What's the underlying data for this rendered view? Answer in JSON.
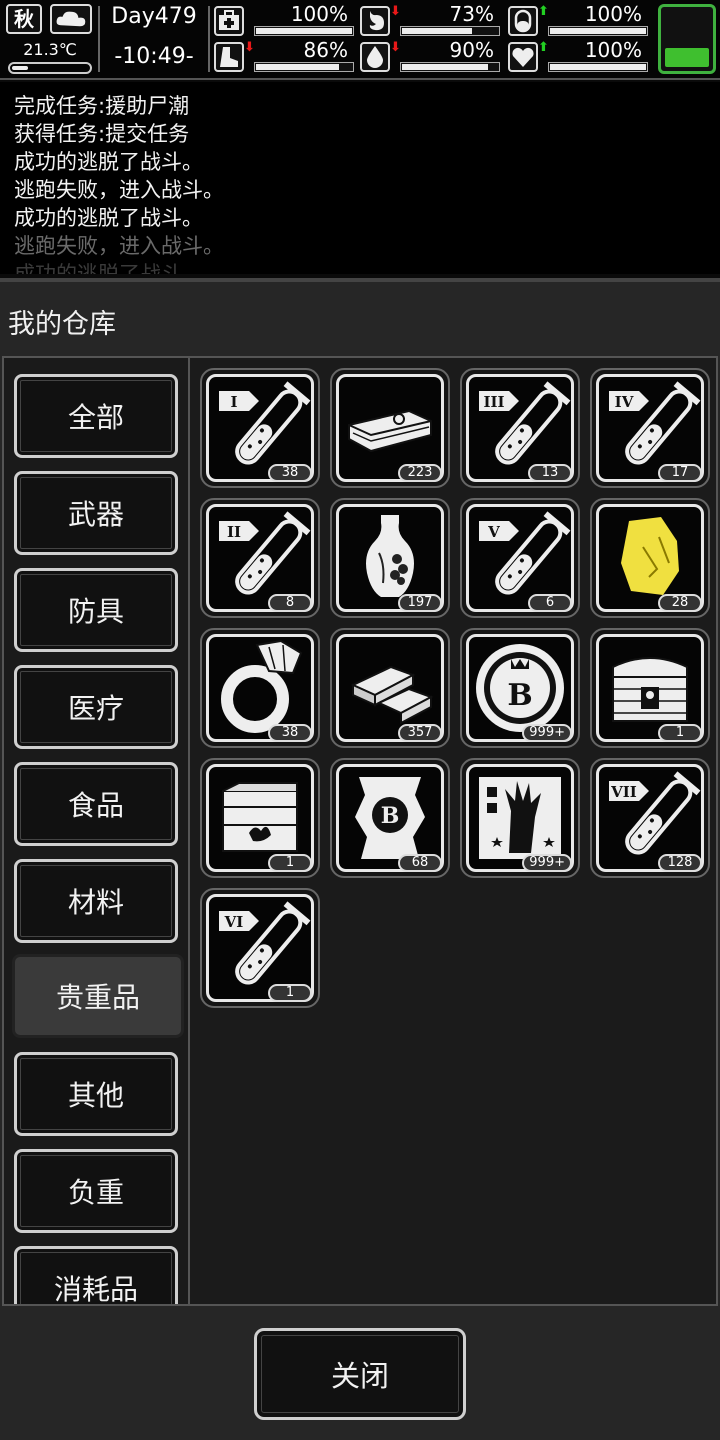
{
  "status": {
    "season": "秋",
    "weather_icon": "cloud-icon",
    "temperature": "21.3℃",
    "temperature_level": 0.2,
    "day": "Day479",
    "time": "-10:49-",
    "stats": [
      {
        "name": "health",
        "icon": "medkit-icon",
        "trend": "none",
        "value": "100%",
        "level": 1.0
      },
      {
        "name": "hunger",
        "icon": "stomach-icon",
        "trend": "down",
        "value": "73%",
        "level": 0.73
      },
      {
        "name": "mood",
        "icon": "pill-icon",
        "trend": "up",
        "value": "100%",
        "level": 1.0
      },
      {
        "name": "stamina",
        "icon": "boot-icon",
        "trend": "down",
        "value": "86%",
        "level": 0.86
      },
      {
        "name": "thirst",
        "icon": "water-drop-icon",
        "trend": "down",
        "value": "90%",
        "level": 0.9
      },
      {
        "name": "spirit",
        "icon": "heart-icon",
        "trend": "up",
        "value": "100%",
        "level": 1.0
      }
    ],
    "battery_level": 0.3,
    "colors": {
      "trend_down": "#e81818",
      "trend_up": "#22d022",
      "battery": "#3fbf2f"
    }
  },
  "log": [
    "完成任务:援助尸潮",
    "获得任务:提交任务",
    "成功的逃脱了战斗。",
    "逃跑失败，进入战斗。",
    "成功的逃脱了战斗。",
    "逃跑失败，进入战斗。",
    "成功的逃脱了战斗。"
  ],
  "panel": {
    "title": "我的仓库",
    "categories": [
      "全部",
      "武器",
      "防具",
      "医疗",
      "食品",
      "材料",
      "贵重品",
      "其他",
      "负重",
      "消耗品"
    ],
    "active_category": "贵重品",
    "items": [
      {
        "icon": "test-tube-I-icon",
        "count": "38"
      },
      {
        "icon": "cash-stack-icon",
        "count": "223"
      },
      {
        "icon": "test-tube-III-icon",
        "count": "13"
      },
      {
        "icon": "test-tube-IV-icon",
        "count": "17"
      },
      {
        "icon": "test-tube-II-icon",
        "count": "8"
      },
      {
        "icon": "vase-icon",
        "count": "197"
      },
      {
        "icon": "test-tube-V-icon",
        "count": "6"
      },
      {
        "icon": "gold-nugget-icon",
        "count": "28"
      },
      {
        "icon": "diamond-ring-icon",
        "count": "38"
      },
      {
        "icon": "gold-bars-icon",
        "count": "357"
      },
      {
        "icon": "b-coin-icon",
        "count": "999+"
      },
      {
        "icon": "treasure-chest-icon",
        "count": "1"
      },
      {
        "icon": "supply-crate-icon",
        "count": "1"
      },
      {
        "icon": "b-voucher-icon",
        "count": "68"
      },
      {
        "icon": "zombie-hand-card-icon",
        "count": "999+"
      },
      {
        "icon": "test-tube-VII-icon",
        "count": "128"
      },
      {
        "icon": "test-tube-VI-icon",
        "count": "1"
      }
    ],
    "tube_labels": [
      "I",
      "III",
      "IV",
      "II",
      "V",
      "VII",
      "VI"
    ],
    "close_label": "关闭"
  }
}
